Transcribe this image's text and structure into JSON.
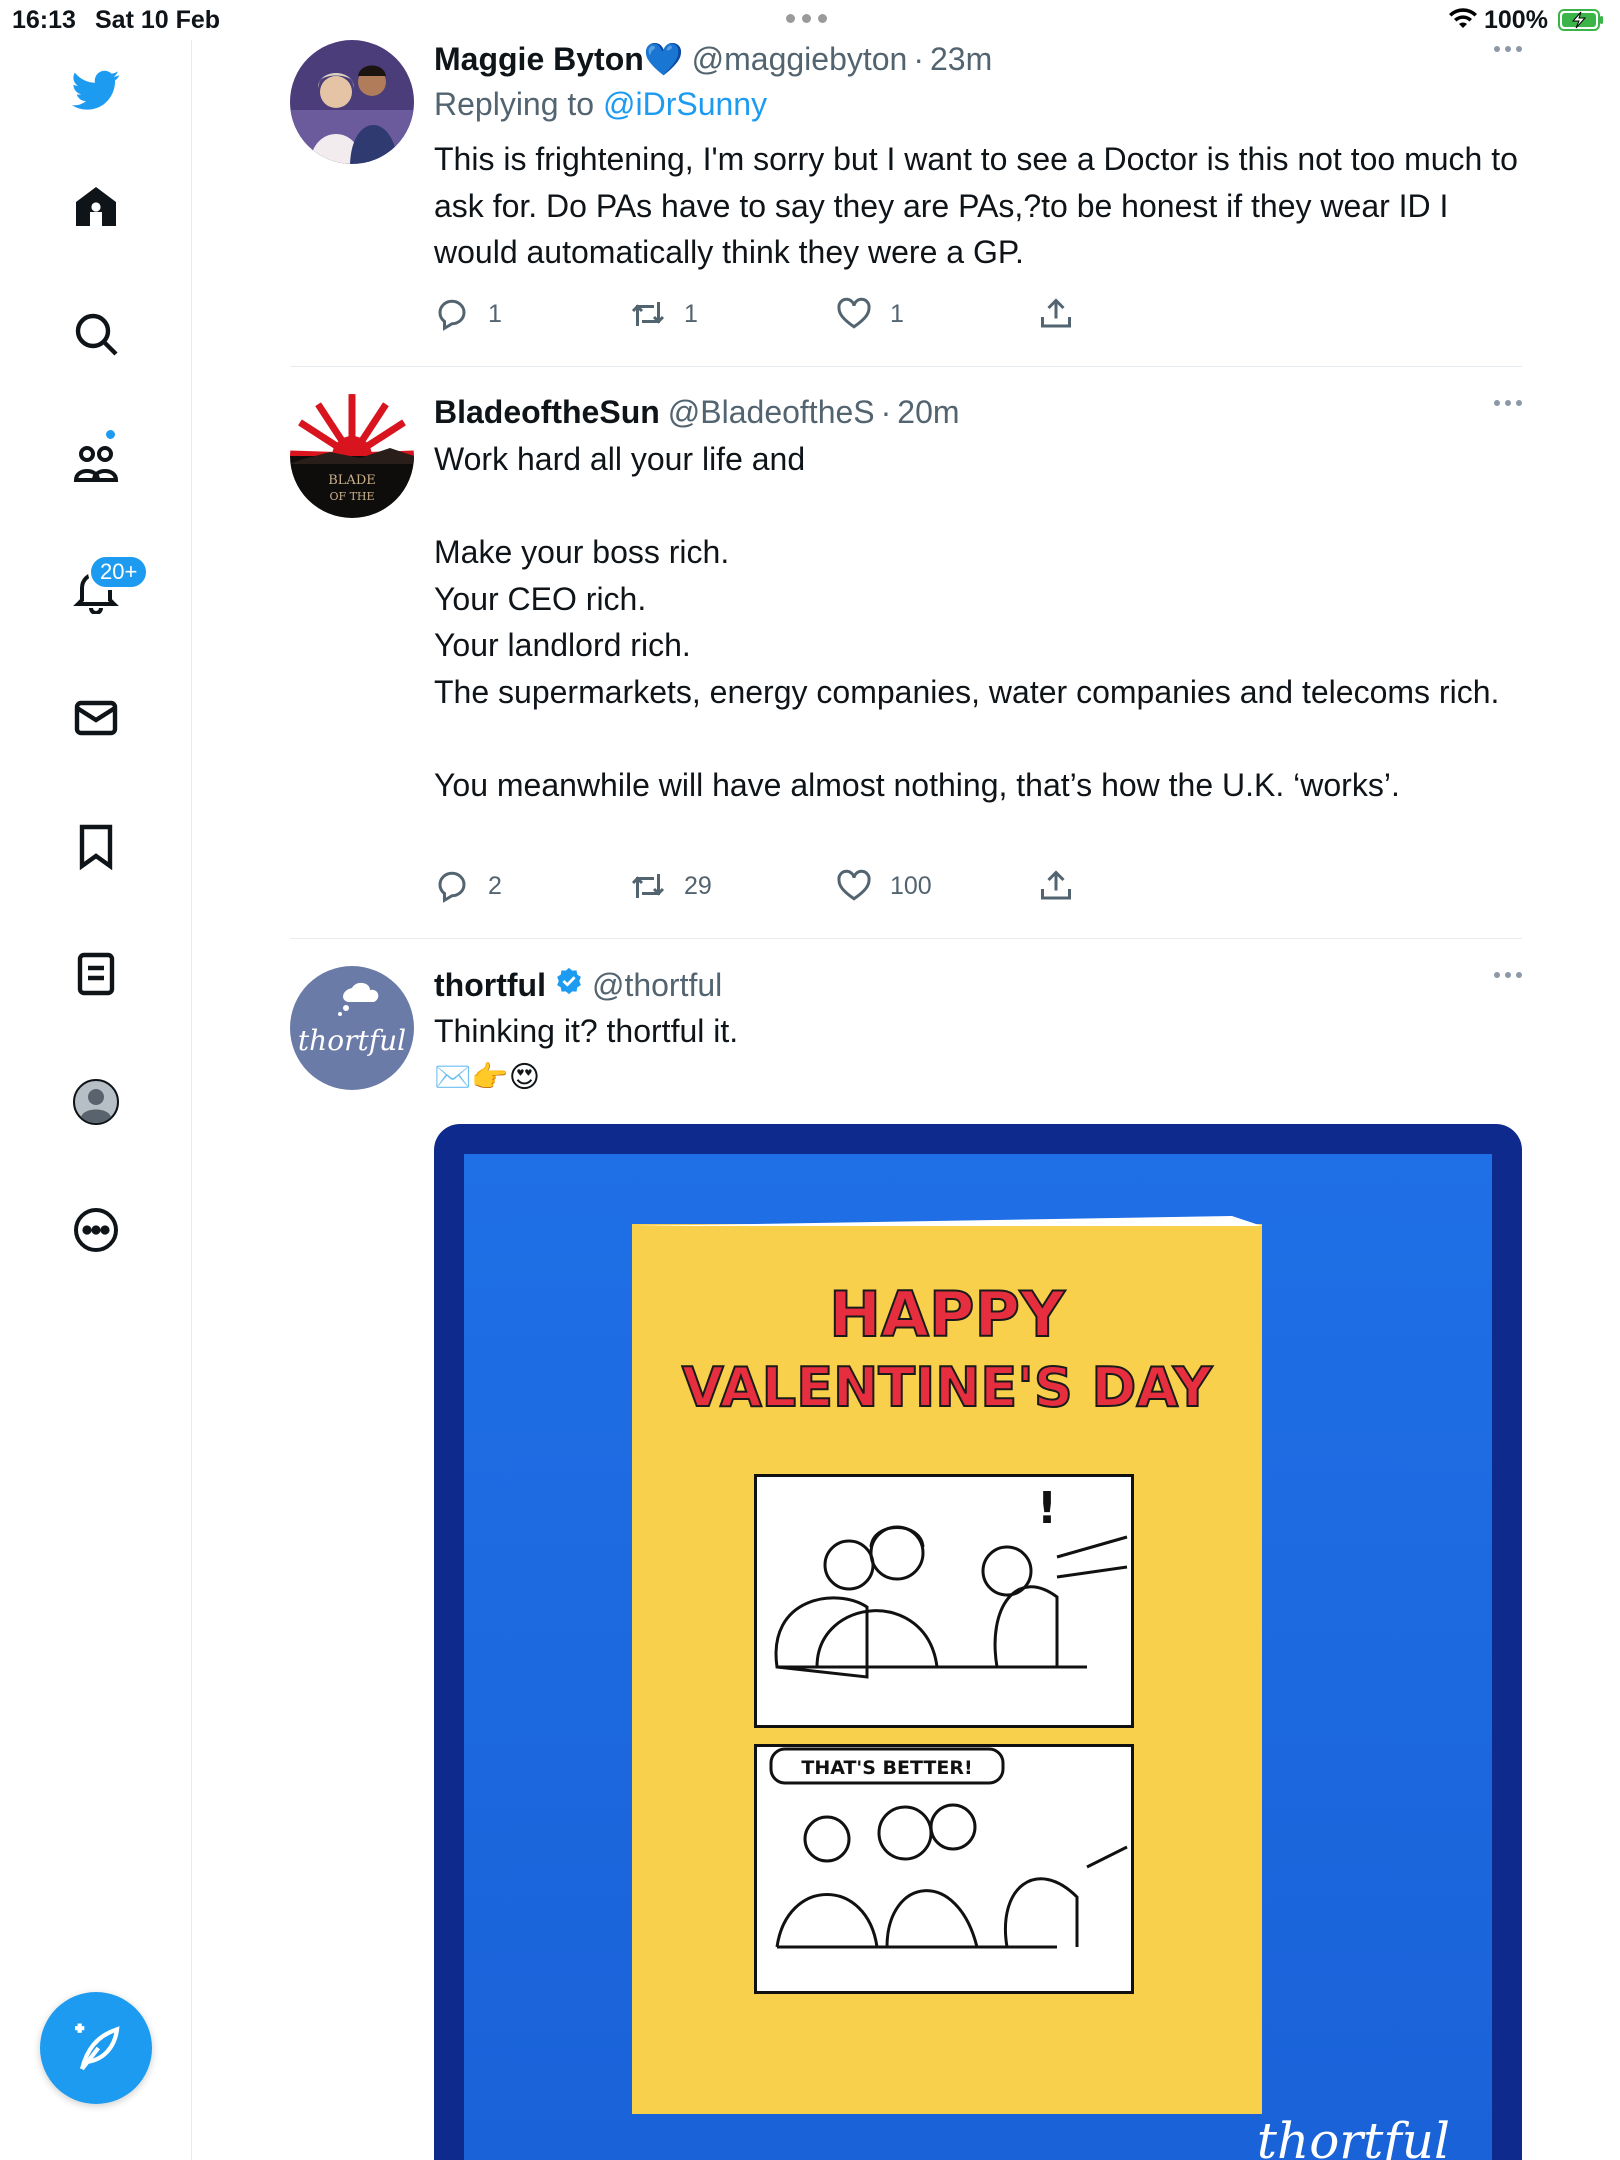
{
  "status_bar": {
    "time": "16:13",
    "date": "Sat 10 Feb",
    "battery": "100%"
  },
  "sidebar": {
    "notifications_badge": "20+",
    "items": [
      "twitter-logo",
      "home",
      "explore",
      "communities",
      "notifications",
      "messages",
      "bookmarks",
      "lists",
      "profile",
      "more"
    ]
  },
  "tweets": [
    {
      "name": "Maggie Byton",
      "name_emoji": "💙",
      "handle": "@maggiebyton",
      "separator": "·",
      "time": "23m",
      "replying_label": "Replying to",
      "replying_to": "@iDrSunny",
      "text": "This is frightening, I'm sorry but I want to see a Doctor is this not too much to ask for. Do PAs have to say they are PAs,?to be honest if they wear ID I would automatically think they were a GP.",
      "replies": "1",
      "retweets": "1",
      "likes": "1"
    },
    {
      "name": "BladeoftheSun",
      "handle": "@BladeoftheS",
      "separator": "·",
      "time": "20m",
      "text": "Work hard all your life and\n\nMake your boss rich.\nYour CEO rich.\nYour landlord rich.\nThe supermarkets, energy companies, water companies and telecoms rich.\n\nYou meanwhile will have almost nothing, that’s how the U.K. ‘works’.",
      "avatar_text": "BLADE OF THE SUN",
      "replies": "2",
      "retweets": "29",
      "likes": "100"
    },
    {
      "name": "thortful",
      "handle": "@thortful",
      "text": "Thinking it? thortful it.",
      "emojis": "✉️👉😍",
      "avatar_text": "thortful",
      "card": {
        "title_line1": "HAPPY",
        "title_line2": "VALENTINE'S DAY",
        "speech": "THAT'S BETTER!",
        "brand": "thortful"
      }
    }
  ],
  "colors": {
    "accent": "#1d9bf0",
    "text": "#0f1419",
    "muted": "#536471",
    "card_yellow": "#f8d04c",
    "card_blue": "#1f6fe6"
  }
}
